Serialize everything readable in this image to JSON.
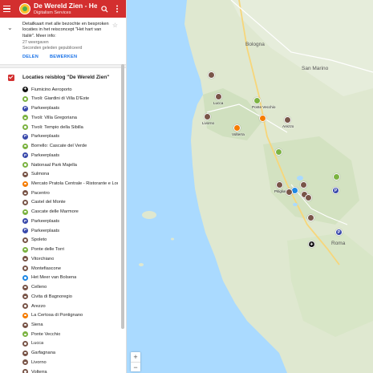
{
  "header": {
    "title": "De Wereld Zien - Het h…",
    "subtitle": "Digitalism Services",
    "search_icon": "search-icon",
    "more_icon": "more-vert-icon"
  },
  "info": {
    "description": "Detailkaart met alle bezochte en besproken locaties in het reisconcept \"Het hart van Italië\". Meer info:",
    "views": "27 weergaven",
    "published": "Seconden geleden gepubliceerd",
    "share_label": "DELEN",
    "edit_label": "BEWERKEN"
  },
  "layer": {
    "name": "Locaties reisblog \"De Wereld Zien\"",
    "items": [
      {
        "label": "Fiumicino Aeroporto",
        "color": "#111111",
        "glyph": "✈"
      },
      {
        "label": "Tivoli: Giardini di Villa D'Este",
        "color": "#7cb342",
        "glyph": "•"
      },
      {
        "label": "Parkeerplaats",
        "color": "#3949ab",
        "glyph": "P"
      },
      {
        "label": "Tivoli: Villa Gregoriana",
        "color": "#7cb342",
        "glyph": "•"
      },
      {
        "label": "Tivoli: Tempio della Sibilla",
        "color": "#7cb342",
        "glyph": "•"
      },
      {
        "label": "Parkeerplaats",
        "color": "#3949ab",
        "glyph": "P"
      },
      {
        "label": "Borrello: Cascate del Verde",
        "color": "#7cb342",
        "glyph": "•"
      },
      {
        "label": "Parkeerplaats",
        "color": "#3949ab",
        "glyph": "P"
      },
      {
        "label": "Nationaal Park Majella",
        "color": "#7cb342",
        "glyph": "•"
      },
      {
        "label": "Sulmona",
        "color": "#795548",
        "glyph": "•"
      },
      {
        "label": "Mercato Pratola Centrale - Ristorante e Loun…",
        "color": "#f57c00",
        "glyph": "•"
      },
      {
        "label": "Pacentro",
        "color": "#795548",
        "glyph": "•"
      },
      {
        "label": "Castel del Monte",
        "color": "#795548",
        "glyph": "•"
      },
      {
        "label": "Cascate delle Marmore",
        "color": "#7cb342",
        "glyph": "•"
      },
      {
        "label": "Parkeerplaats",
        "color": "#3949ab",
        "glyph": "P"
      },
      {
        "label": "Parkeerplaats",
        "color": "#3949ab",
        "glyph": "P"
      },
      {
        "label": "Spoleto",
        "color": "#795548",
        "glyph": "•"
      },
      {
        "label": "Ponte delle Torri",
        "color": "#7cb342",
        "glyph": "•"
      },
      {
        "label": "Vitorchiano",
        "color": "#795548",
        "glyph": "•"
      },
      {
        "label": "Montefiascone",
        "color": "#795548",
        "glyph": "•"
      },
      {
        "label": "Het Meer van Bolsena",
        "color": "#1e88e5",
        "glyph": "•"
      },
      {
        "label": "Celleno",
        "color": "#795548",
        "glyph": "•"
      },
      {
        "label": "Civita di Bagnoregio",
        "color": "#795548",
        "glyph": "•"
      },
      {
        "label": "Arezzo",
        "color": "#795548",
        "glyph": "•"
      },
      {
        "label": "La Certosa di Pontignano",
        "color": "#f57c00",
        "glyph": "•"
      },
      {
        "label": "Siena",
        "color": "#795548",
        "glyph": "•"
      },
      {
        "label": "Ponte Vecchio",
        "color": "#7cb342",
        "glyph": "•"
      },
      {
        "label": "Lucca",
        "color": "#795548",
        "glyph": "•"
      },
      {
        "label": "Garfagnana",
        "color": "#795548",
        "glyph": "•"
      },
      {
        "label": "Livorno",
        "color": "#795548",
        "glyph": "•"
      },
      {
        "label": "Volterra",
        "color": "#795548",
        "glyph": "•"
      }
    ]
  },
  "map": {
    "cities": [
      {
        "name": "Bologna"
      },
      {
        "name": "San Marino"
      },
      {
        "name": "Roma"
      }
    ],
    "pins": [
      {
        "label": "Lucca",
        "color": "#795548"
      },
      {
        "label": "Ponte Vecchio",
        "color": "#7cb342"
      },
      {
        "label": "Livorno",
        "color": "#795548"
      },
      {
        "label": "Volterra",
        "color": "#f57c00"
      },
      {
        "label": "Arezzo",
        "color": "#795548"
      },
      {
        "label": "Pitigliano",
        "color": "#795548"
      }
    ],
    "zoom_in": "+",
    "zoom_out": "−"
  }
}
